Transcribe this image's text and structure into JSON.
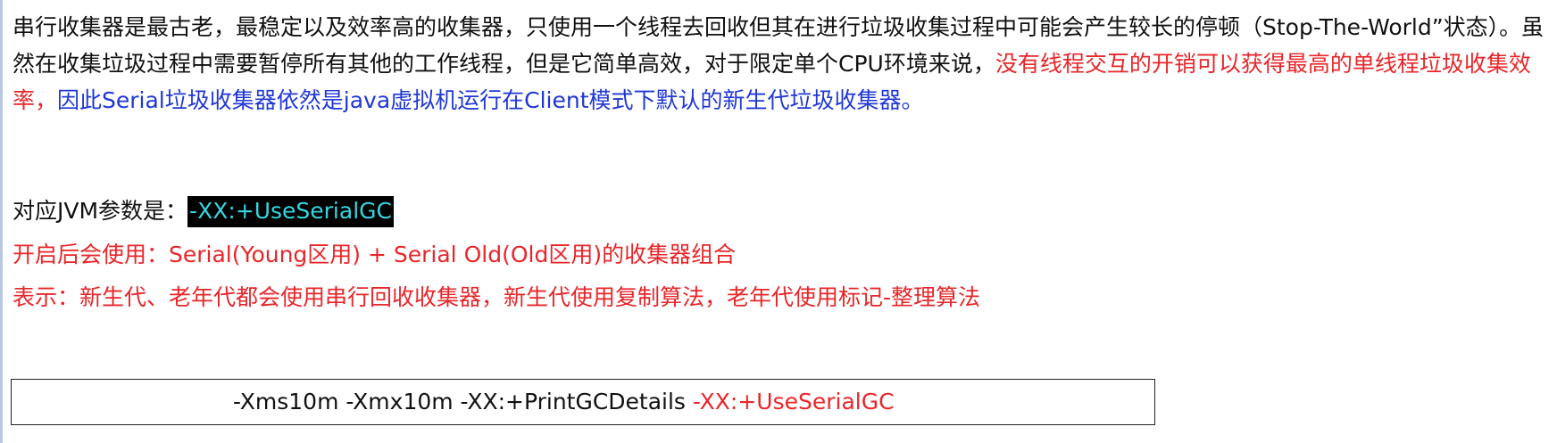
{
  "intro": {
    "seg_black": "串行收集器是最古老，最稳定以及效率高的收集器，只使用一个线程去回收但其在进行垃圾收集过程中可能会产生较长的停顿（Stop-The-World”状态）。虽然在收集垃圾过程中需要暂停所有其他的工作线程，但是它简单高效，对于限定单个CPU环境来说，",
    "seg_red": "没有线程交互的开销可以获得最高的单线程垃圾收集效率，",
    "seg_blue": "因此Serial垃圾收集器依然是java虚拟机运行在Client模式下默认的新生代垃圾收集器。"
  },
  "jvm_param": {
    "label": "对应JVM参数是：",
    "value": "-XX:+UseSerialGC"
  },
  "enable_line": {
    "text": "开启后会使用：Serial(Young区用) + Serial Old(Old区用)的收集器组合"
  },
  "meaning_line": {
    "text": "表示：新生代、老年代都会使用串行回收收集器，新生代使用复制算法，老年代使用标记-整理算法"
  },
  "command_box": {
    "plain": "-Xms10m -Xmx10m -XX:+PrintGCDetails ",
    "highlight": "-XX:+UseSerialGC"
  },
  "colors": {
    "red": "#e8262a",
    "blue": "#1f37d6",
    "highlight_bg": "#000000",
    "highlight_text": "#35d6e0"
  }
}
